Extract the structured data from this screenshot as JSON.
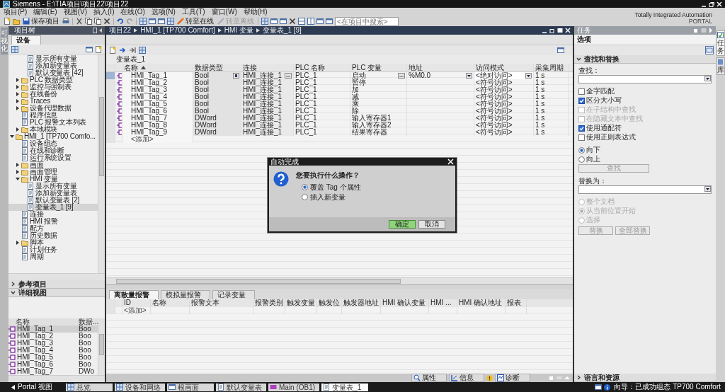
{
  "window": {
    "title": "Siemens  -  E:\\TIA项目\\项目22\\项目22"
  },
  "menu": [
    "项目(P)",
    "编辑(E)",
    "视图(V)",
    "插入(I)",
    "在线(O)",
    "选项(N)",
    "工具(T)",
    "窗口(W)",
    "帮助(H)"
  ],
  "toolbar": {
    "save": "保存项目",
    "go_online": "转至在线",
    "go_offline": "转至离线",
    "search": {
      "placeholder": "<在项目中搜索>"
    }
  },
  "brand": {
    "line1": "Totally Integrated Automation",
    "line2": "PORTAL"
  },
  "left_strip": {
    "label": "可视化"
  },
  "project_tree": {
    "title": "项目树",
    "tab": "设备",
    "items": [
      {
        "children": [
          {
            "children": [
              {
                "label": "显示所有变量"
              },
              {
                "label": "添加新变量表"
              },
              {
                "label": "默认变量表 [42]"
              }
            ]
          },
          {
            "label": "PLC 数据类型",
            "expanded": false
          },
          {
            "label": "监控与强制表",
            "expanded": false
          },
          {
            "label": "在线备份",
            "expanded": false
          },
          {
            "label": "Traces",
            "expanded": false
          },
          {
            "label": "设备代理数据",
            "expanded": false
          },
          {
            "label": "程序信息"
          },
          {
            "label": "PLC 报警文本列表"
          },
          {
            "label": "本地模块",
            "expanded": false
          }
        ]
      },
      {
        "label": "HMI_1 [TP700 Comfo...",
        "expanded": true,
        "children": [
          {
            "label": "设备组态"
          },
          {
            "label": "在线和诊断"
          },
          {
            "label": "运行系统设置"
          },
          {
            "label": "画面",
            "expanded": false
          },
          {
            "label": "画面管理",
            "expanded": false
          },
          {
            "label": "HMI 变量",
            "expanded": true,
            "children": [
              {
                "label": "显示所有变量"
              },
              {
                "label": "添加新变量表"
              },
              {
                "label": "默认变量表 [2]"
              },
              {
                "label": "变量表_1 [9]",
                "selected": true
              }
            ]
          },
          {
            "label": "连接"
          },
          {
            "label": "HMI 报警"
          },
          {
            "label": "配方"
          },
          {
            "label": "历史数据"
          },
          {
            "label": "脚本",
            "expanded": false
          },
          {
            "label": "计划任务"
          },
          {
            "label": "周期"
          }
        ]
      }
    ],
    "reference_section": {
      "label": "参考项目",
      "expanded": false
    },
    "detail_section": {
      "label": "详细视图",
      "expanded": true
    },
    "detail_table": {
      "columns": [
        "名称",
        "数据..."
      ],
      "rows": [
        {
          "name": "HMI_Tag_1",
          "type": "Boo",
          "selected": true
        },
        {
          "name": "HMI_Tag_2",
          "type": "Boo",
          "selected": false
        },
        {
          "name": "HMI_Tag_3",
          "type": "Boo",
          "selected": false
        },
        {
          "name": "HMI_Tag_4",
          "type": "Boo",
          "selected": false
        },
        {
          "name": "HMI_Tag_5",
          "type": "Boo",
          "selected": false
        },
        {
          "name": "HMI_Tag_6",
          "type": "Boo",
          "selected": false
        },
        {
          "name": "HMI_Tag_7",
          "type": "DWo",
          "selected": false
        }
      ]
    }
  },
  "editor": {
    "breadcrumb": [
      "项目22",
      "HMI_1 [TP700 Comfort]",
      "HMI 变量",
      "变量表_1 [9]"
    ],
    "table_title": "变量表_1",
    "columns": [
      {
        "label": "名称",
        "sorted": true
      },
      {
        "label": "数据类型",
        "sorted": false
      },
      {
        "label": "连接",
        "sorted": false
      },
      {
        "label": "PLC 名称",
        "sorted": false
      },
      {
        "label": "PLC 变量",
        "sorted": false
      },
      {
        "label": "地址",
        "sorted": false
      },
      {
        "label": "访问模式",
        "sorted": false
      },
      {
        "label": "采集周期",
        "sorted": false
      }
    ],
    "rows": [
      {
        "name": "HMI_Tag_1",
        "data_type": "Bool",
        "connection": "HMI_连接_1",
        "plc_name": "PLC_1",
        "plc_tag": "启动",
        "address": "%M0.0",
        "access_mode": "<绝对访问>",
        "cycle": "1 s",
        "selected": true
      },
      {
        "name": "HMI_Tag_2",
        "data_type": "Bool",
        "connection": "HMI_连接_1",
        "plc_name": "PLC_1",
        "plc_tag": "暂停",
        "access_mode": "<符号访问>",
        "cycle": "1 s",
        "selected": false
      },
      {
        "name": "HMI_Tag_3",
        "data_type": "Bool",
        "connection": "HMI_连接_1",
        "plc_name": "PLC_1",
        "plc_tag": "加",
        "access_mode": "<符号访问>",
        "cycle": "1 s",
        "selected": false
      },
      {
        "name": "HMI_Tag_4",
        "data_type": "Bool",
        "connection": "HMI_连接_1",
        "plc_name": "PLC_1",
        "plc_tag": "减",
        "access_mode": "<符号访问>",
        "cycle": "1 s",
        "selected": false
      },
      {
        "name": "HMI_Tag_5",
        "data_type": "Bool",
        "connection": "HMI_连接_1",
        "plc_name": "PLC_1",
        "plc_tag": "乘",
        "access_mode": "<符号访问>",
        "cycle": "1 s",
        "selected": false
      },
      {
        "name": "HMI_Tag_6",
        "data_type": "Bool",
        "connection": "HMI_连接_1",
        "plc_name": "PLC_1",
        "plc_tag": "除",
        "access_mode": "<符号访问>",
        "cycle": "1 s",
        "selected": false
      },
      {
        "name": "HMI_Tag_7",
        "data_type": "DWord",
        "connection": "HMI_连接_1",
        "plc_name": "PLC_1",
        "plc_tag": "输入寄存器1",
        "access_mode": "<符号访问>",
        "cycle": "1 s",
        "selected": false
      },
      {
        "name": "HMI_Tag_8",
        "data_type": "DWord",
        "connection": "HMI_连接_1",
        "plc_name": "PLC_1",
        "plc_tag": "输入寄存器2",
        "access_mode": "<符号访问>",
        "cycle": "1 s",
        "selected": false
      },
      {
        "name": "HMI_Tag_9",
        "data_type": "DWord",
        "connection": "HMI_连接_1",
        "plc_name": "PLC_1",
        "plc_tag": "结果寄存器",
        "access_mode": "<符号访问>",
        "cycle": "1 s",
        "selected": false
      }
    ],
    "add_row": "<添加>",
    "lower_tabs": [
      {
        "label": "离散量报警",
        "selected": true
      },
      {
        "label": "模拟量报警",
        "selected": false
      },
      {
        "label": "记录变量",
        "selected": false
      }
    ],
    "alarm_columns": [
      "ID",
      "名称",
      "报警文本",
      "报警类别",
      "触发变量",
      "触发位",
      "触发器地址",
      "HMI 确认变量",
      "HMI ...",
      "HMI 确认地址",
      "报表"
    ],
    "alarm_add_row": "<添加>",
    "bottom_tabs": [
      {
        "label": "属性",
        "selected": false
      },
      {
        "label": "信息",
        "selected": false
      },
      {
        "label": "诊断",
        "selected": false
      }
    ]
  },
  "task_panel": {
    "title": "任务",
    "options": "选项",
    "section": {
      "label": "查找和替换",
      "expanded": true
    },
    "find_label": "查找：",
    "checks": [
      {
        "label": "全字匹配",
        "checked": false,
        "disabled": false
      },
      {
        "label": "区分大小写",
        "checked": true,
        "disabled": false
      },
      {
        "label": "在子结构中查找",
        "checked": false,
        "disabled": true
      },
      {
        "label": "在隐藏文本中查找",
        "checked": false,
        "disabled": true
      },
      {
        "label": "使用通配符",
        "checked": true,
        "disabled": false
      },
      {
        "label": "使用正则表达式",
        "checked": false,
        "disabled": false
      }
    ],
    "directions": [
      {
        "label": "向下",
        "selected": true
      },
      {
        "label": "向上",
        "selected": false
      }
    ],
    "find_button": {
      "label": "查找",
      "disabled": true
    },
    "replace_label": "替换为：",
    "scopes": [
      {
        "label": "整个文档",
        "selected": false,
        "disabled": true
      },
      {
        "label": "从当前位置开始",
        "selected": true,
        "disabled": true
      },
      {
        "label": "选择",
        "selected": false,
        "disabled": true
      }
    ],
    "replace_buttons": [
      {
        "label": "替换",
        "disabled": true
      },
      {
        "label": "全部替换",
        "disabled": true
      }
    ],
    "footer": {
      "label": "语言和资源",
      "expanded": false
    }
  },
  "side_tabs": [
    {
      "label": "任务",
      "selected": true
    },
    {
      "label": "库",
      "selected": false
    }
  ],
  "dialog": {
    "title": "自动完成",
    "question": "您要执行什么操作？",
    "options": [
      {
        "label": "覆盖 Tag 个属性",
        "selected": true
      },
      {
        "label": "插入新变量",
        "selected": false
      }
    ],
    "ok": "确定",
    "cancel": "取消"
  },
  "taskbar": {
    "portal": "Portal 视图",
    "items": [
      {
        "label": "总览",
        "selected": false
      },
      {
        "label": "设备和网络",
        "selected": false
      },
      {
        "label": "根画面",
        "selected": false
      },
      {
        "label": "默认变量表",
        "selected": false
      },
      {
        "label": "Main (OB1)",
        "selected": false
      },
      {
        "label": "变量表_1",
        "selected": true
      }
    ],
    "status": "向导：已成功组态 TP700 Comfort"
  }
}
